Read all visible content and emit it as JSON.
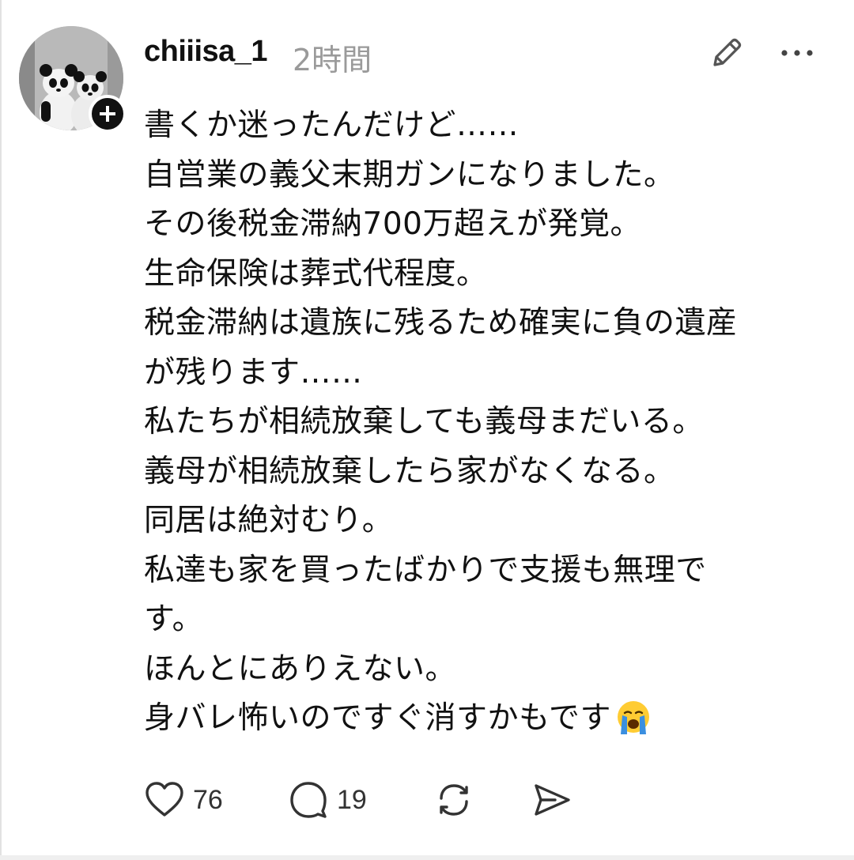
{
  "post": {
    "author": {
      "username": "chiiisa_1",
      "avatar": "panda-avatar",
      "follow_icon": "plus-icon"
    },
    "timestamp": "2時間",
    "header_icons": [
      "edit-icon",
      "more-icon"
    ],
    "lines": [
      "書くか迷ったんだけど……",
      "自営業の義父末期ガンになりました。",
      "その後税金滞納700万超えが発覚。",
      "生命保険は葬式代程度。",
      "税金滞納は遺族に残るため確実に負の遺産",
      "が残ります……",
      "私たちが相続放棄しても義母まだいる。",
      "義母が相続放棄したら家がなくなる。",
      "同居は絶対むり。",
      "私達も家を買ったばかりで支援も無理で",
      "す。",
      "ほんとにありえない。",
      "身バレ怖いのですぐ消すかもです"
    ],
    "last_line_emoji": "loudly-crying-face-emoji"
  },
  "actions": {
    "like": {
      "icon": "heart-icon",
      "count": "76"
    },
    "comment": {
      "icon": "comment-icon",
      "count": "19"
    },
    "repost": {
      "icon": "repost-icon"
    },
    "share": {
      "icon": "send-icon"
    }
  },
  "colors": {
    "text": "#111111",
    "muted": "#9a9a9a",
    "icon": "#333333",
    "emoji_face": "#ffcc33",
    "emoji_tears": "#3b8fe0"
  }
}
